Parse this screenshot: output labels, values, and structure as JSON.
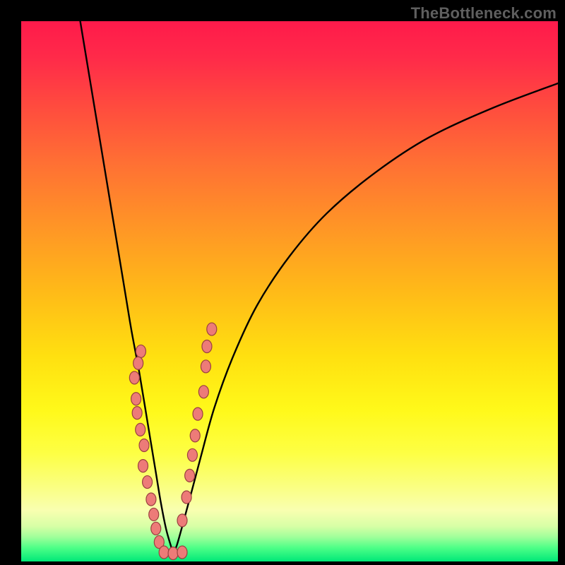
{
  "watermark": "TheBottleneck.com",
  "gradient": {
    "stops": [
      {
        "offset": 0.0,
        "color": "#ff1a4b"
      },
      {
        "offset": 0.07,
        "color": "#ff2b49"
      },
      {
        "offset": 0.16,
        "color": "#ff4c3e"
      },
      {
        "offset": 0.26,
        "color": "#ff6f34"
      },
      {
        "offset": 0.38,
        "color": "#ff9526"
      },
      {
        "offset": 0.5,
        "color": "#ffba18"
      },
      {
        "offset": 0.62,
        "color": "#ffe010"
      },
      {
        "offset": 0.72,
        "color": "#fff91a"
      },
      {
        "offset": 0.8,
        "color": "#fdff44"
      },
      {
        "offset": 0.86,
        "color": "#faff80"
      },
      {
        "offset": 0.905,
        "color": "#f9ffb0"
      },
      {
        "offset": 0.935,
        "color": "#d7ffa6"
      },
      {
        "offset": 0.955,
        "color": "#9fff9a"
      },
      {
        "offset": 0.975,
        "color": "#4cff87"
      },
      {
        "offset": 1.0,
        "color": "#00e878"
      }
    ]
  },
  "curve": {
    "stroke": "#000000",
    "stroke_width": 2.4
  },
  "markers": {
    "fill": "#ed7b78",
    "stroke": "#9a403f",
    "stroke_width": 1.2,
    "rx": 7,
    "ry": 9,
    "left_points": [
      {
        "x_pct": 22.3,
        "y_pct": 61.1
      },
      {
        "x_pct": 21.8,
        "y_pct": 63.3
      },
      {
        "x_pct": 21.1,
        "y_pct": 66.0
      },
      {
        "x_pct": 21.4,
        "y_pct": 69.9
      },
      {
        "x_pct": 21.6,
        "y_pct": 72.5
      },
      {
        "x_pct": 22.2,
        "y_pct": 75.6
      },
      {
        "x_pct": 22.9,
        "y_pct": 78.5
      },
      {
        "x_pct": 22.7,
        "y_pct": 82.3
      },
      {
        "x_pct": 23.5,
        "y_pct": 85.3
      },
      {
        "x_pct": 24.2,
        "y_pct": 88.5
      },
      {
        "x_pct": 24.7,
        "y_pct": 91.3
      },
      {
        "x_pct": 25.1,
        "y_pct": 93.9
      },
      {
        "x_pct": 25.7,
        "y_pct": 96.4
      }
    ],
    "right_points": [
      {
        "x_pct": 35.5,
        "y_pct": 57.0
      },
      {
        "x_pct": 34.6,
        "y_pct": 60.2
      },
      {
        "x_pct": 34.4,
        "y_pct": 63.9
      },
      {
        "x_pct": 34.0,
        "y_pct": 68.6
      },
      {
        "x_pct": 32.9,
        "y_pct": 72.7
      },
      {
        "x_pct": 32.4,
        "y_pct": 76.7
      },
      {
        "x_pct": 31.9,
        "y_pct": 80.3
      },
      {
        "x_pct": 31.4,
        "y_pct": 84.1
      },
      {
        "x_pct": 30.8,
        "y_pct": 88.1
      },
      {
        "x_pct": 30.0,
        "y_pct": 92.4
      }
    ],
    "bottom_points": [
      {
        "x_pct": 26.6,
        "y_pct": 98.3
      },
      {
        "x_pct": 28.3,
        "y_pct": 98.5
      },
      {
        "x_pct": 30.0,
        "y_pct": 98.3
      }
    ]
  },
  "chart_data": {
    "type": "line",
    "title": "",
    "xlabel": "",
    "ylabel": "",
    "xlim": [
      0,
      100
    ],
    "ylim": [
      0,
      100
    ],
    "note": "x and y are percentages of the plot area; y=0 at top, y=100 at bottom (bottleneck % style plot). Two branches of a V-shaped curve with scatter markers near the bottom.",
    "series": [
      {
        "name": "left-branch",
        "x": [
          11.0,
          13.0,
          15.0,
          17.0,
          19.0,
          20.5,
          22.0,
          23.5,
          25.0,
          26.0,
          27.0,
          28.0,
          28.3
        ],
        "y": [
          0.0,
          12.0,
          24.0,
          36.0,
          48.0,
          57.0,
          65.0,
          74.0,
          83.0,
          89.0,
          94.0,
          97.5,
          98.7
        ]
      },
      {
        "name": "right-branch",
        "x": [
          28.3,
          29.0,
          30.0,
          31.5,
          33.5,
          36.0,
          39.5,
          44.0,
          50.0,
          57.0,
          66.0,
          76.0,
          88.0,
          100.0
        ],
        "y": [
          98.7,
          97.0,
          93.5,
          88.0,
          80.5,
          71.5,
          62.0,
          52.5,
          43.5,
          35.5,
          28.0,
          21.5,
          16.0,
          11.5
        ]
      }
    ],
    "scatter": {
      "name": "highlighted-points",
      "points_pct": [
        [
          22.3,
          61.1
        ],
        [
          21.8,
          63.3
        ],
        [
          21.1,
          66.0
        ],
        [
          21.4,
          69.9
        ],
        [
          21.6,
          72.5
        ],
        [
          22.2,
          75.6
        ],
        [
          22.9,
          78.5
        ],
        [
          22.7,
          82.3
        ],
        [
          23.5,
          85.3
        ],
        [
          24.2,
          88.5
        ],
        [
          24.7,
          91.3
        ],
        [
          25.1,
          93.9
        ],
        [
          25.7,
          96.4
        ],
        [
          35.5,
          57.0
        ],
        [
          34.6,
          60.2
        ],
        [
          34.4,
          63.9
        ],
        [
          34.0,
          68.6
        ],
        [
          32.9,
          72.7
        ],
        [
          32.4,
          76.7
        ],
        [
          31.9,
          80.3
        ],
        [
          31.4,
          84.1
        ],
        [
          30.8,
          88.1
        ],
        [
          30.0,
          92.4
        ],
        [
          26.6,
          98.3
        ],
        [
          28.3,
          98.5
        ],
        [
          30.0,
          98.3
        ]
      ]
    }
  }
}
